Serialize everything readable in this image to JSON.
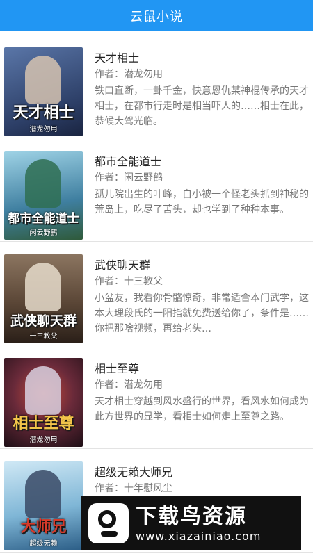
{
  "app": {
    "title": "云鼠小说"
  },
  "books": [
    {
      "title": "天才相士",
      "author": "作者：潜龙勿用",
      "desc": "铁口直断，一卦千金，快意恩仇某神棍传承的天才相士，在都市行走时是相当吓人的……相士在此，恭候大驾光临。",
      "cover_title": "天才相士",
      "cover_author": "潜龙勿用",
      "cover_bg": "#2c3e66",
      "cover_fg": "#8aa0c8"
    },
    {
      "title": "都市全能道士",
      "author": "作者：闲云野鹤",
      "desc": "孤儿院出生的叶峰，自小被一个怪老头抓到神秘的荒岛上，吃尽了苦头，却也学到了种种本事。",
      "cover_title": "都市全能道士",
      "cover_author": "闲云野鹤",
      "cover_bg": "#3f7fa0",
      "cover_fg": "#6fbf9a"
    },
    {
      "title": "武侠聊天群",
      "author": "作者：十三教父",
      "desc": "小盆友，我看你骨骼惊奇，非常适合本门武学，这本大理段氏的一阳指就免费送给你了，条件是……你把那啥视频，再给老头…",
      "cover_title": "武侠聊天群",
      "cover_author": "十三教父",
      "cover_bg": "#5a4636",
      "cover_fg": "#c9b79a"
    },
    {
      "title": "相士至尊",
      "author": "作者：潜龙勿用",
      "desc": "天才相士穿越到风水盛行的世界，看风水如何成为此方世界的显学，看相士如何走上至尊之路。",
      "cover_title": "相士至尊",
      "cover_author": "潜龙勿用",
      "cover_bg": "#3a1f2a",
      "cover_fg": "#c64a3a"
    },
    {
      "title": "超级无赖大师兄",
      "author": "作者：十年慰风尘",
      "desc": "",
      "cover_title": "大师兄",
      "cover_author": "超级无赖",
      "cover_bg": "#7fb6d6",
      "cover_fg": "#2b5d86"
    }
  ],
  "watermark": {
    "name": "下载鸟资源",
    "url": "www.xiazainiao.com"
  }
}
